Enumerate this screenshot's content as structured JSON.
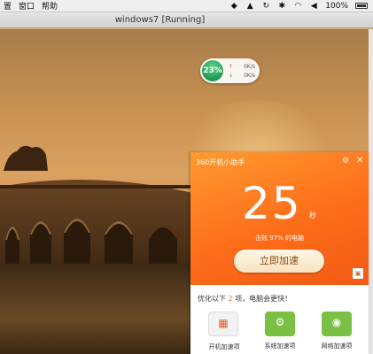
{
  "menubar": {
    "menus": [
      "置",
      "窗口",
      "帮助"
    ],
    "battery": "100%"
  },
  "vm": {
    "title": "windows7 [Running]"
  },
  "speed_ball": {
    "percent": "23%",
    "up": "0K/s",
    "down": "0K/s"
  },
  "panel": {
    "title": "360开机小助手",
    "seconds": "25",
    "seconds_unit": "秒",
    "beat_text": "击败 97% 的电脑",
    "accelerate_button": "立即加速",
    "optimize_prefix": "优化以下",
    "optimize_count": "2",
    "optimize_suffix": "项，电脑会更快！",
    "items": [
      {
        "label": "开机加速项",
        "icon": "startup-icon"
      },
      {
        "label": "系统加速项",
        "icon": "system-icon"
      },
      {
        "label": "网络加速项",
        "icon": "network-icon"
      }
    ]
  },
  "colors": {
    "accent": "#fd6d1a",
    "green": "#7ac143"
  }
}
